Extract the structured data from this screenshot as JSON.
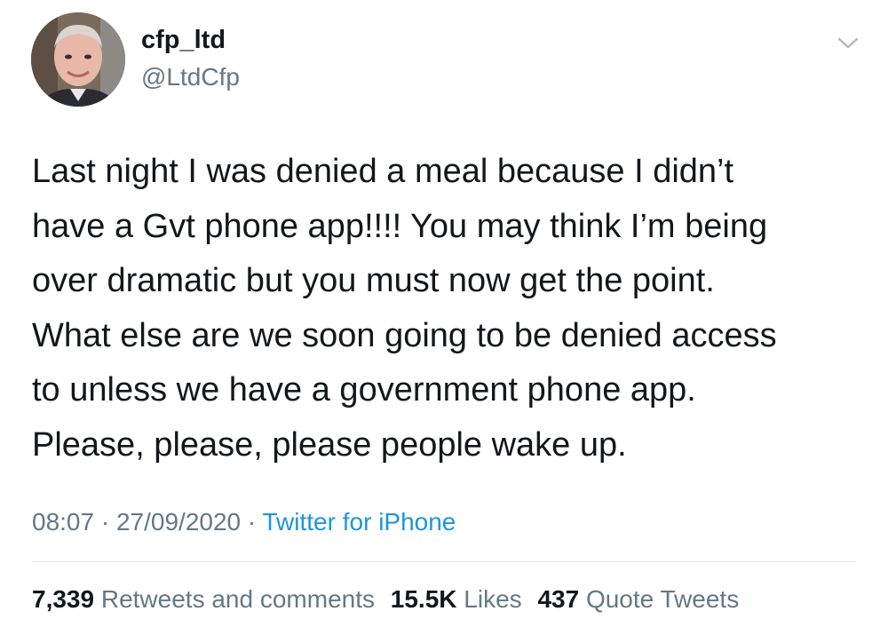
{
  "user": {
    "display_name": "cfp_ltd",
    "handle": "@LtdCfp",
    "avatar_icon": "user-avatar"
  },
  "tweet": {
    "lines": [
      "Last night I was denied a meal because I didn’t",
      "have a Gvt phone app!!!! You may think I’m being",
      "over dramatic but you must now get the point.",
      "What else are we soon going to be denied access",
      "to unless we have a government phone app.",
      "Please, please, please people wake up."
    ]
  },
  "meta": {
    "time": "08:07",
    "separator": "·",
    "date": "27/09/2020",
    "source": "Twitter for iPhone"
  },
  "stats": {
    "retweets_count": "7,339",
    "retweets_label": "Retweets and comments",
    "likes_count": "15.5K",
    "likes_label": "Likes",
    "quotes_count": "437",
    "quotes_label": "Quote Tweets"
  },
  "colors": {
    "text": "#14171a",
    "secondary": "#657786",
    "link": "#1b95e0",
    "divider": "#e1e8ed"
  },
  "icons": {
    "menu": "chevron-down-icon"
  }
}
